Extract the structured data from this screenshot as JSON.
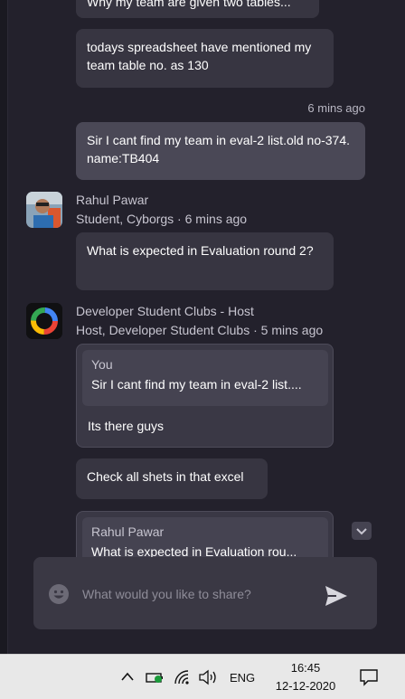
{
  "messages": {
    "partial_top": "Why my team are given two tables...",
    "msg1": "todays spreadsheet have mentioned my team table no. as 130",
    "time1": "6 mins ago",
    "msg2": "Sir I cant find my team in eval-2 list.old no-374. name:TB404",
    "rahul": {
      "name": "Rahul Pawar",
      "meta": "Student, Cyborgs · 6 mins ago",
      "text": "What is expected in Evaluation round 2?"
    },
    "dsc": {
      "name": "Developer Student Clubs - Host",
      "meta": "Host, Developer Student Clubs · 5 mins ago",
      "quote_name": "You",
      "quote_text": "Sir I cant find my team in eval-2 list....",
      "reply": "Its there guys",
      "msg2": "Check all shets in that excel",
      "quote2_name": "Rahul Pawar",
      "quote2_text": "What is expected in Evaluation rou..."
    }
  },
  "composer": {
    "placeholder": "What would you like to share?"
  },
  "taskbar": {
    "lang": "ENG",
    "time": "16:45",
    "date": "12-12-2020"
  },
  "colors": {
    "background": "#23212c",
    "bubble": "#373541",
    "bubble_self": "#4a4856",
    "taskbar": "#e8e8e8"
  },
  "icons": [
    "emoji-icon",
    "send-icon",
    "chevron-down-icon",
    "chevron-up-icon",
    "battery-icon",
    "wifi-icon",
    "speaker-icon",
    "notification-icon"
  ]
}
